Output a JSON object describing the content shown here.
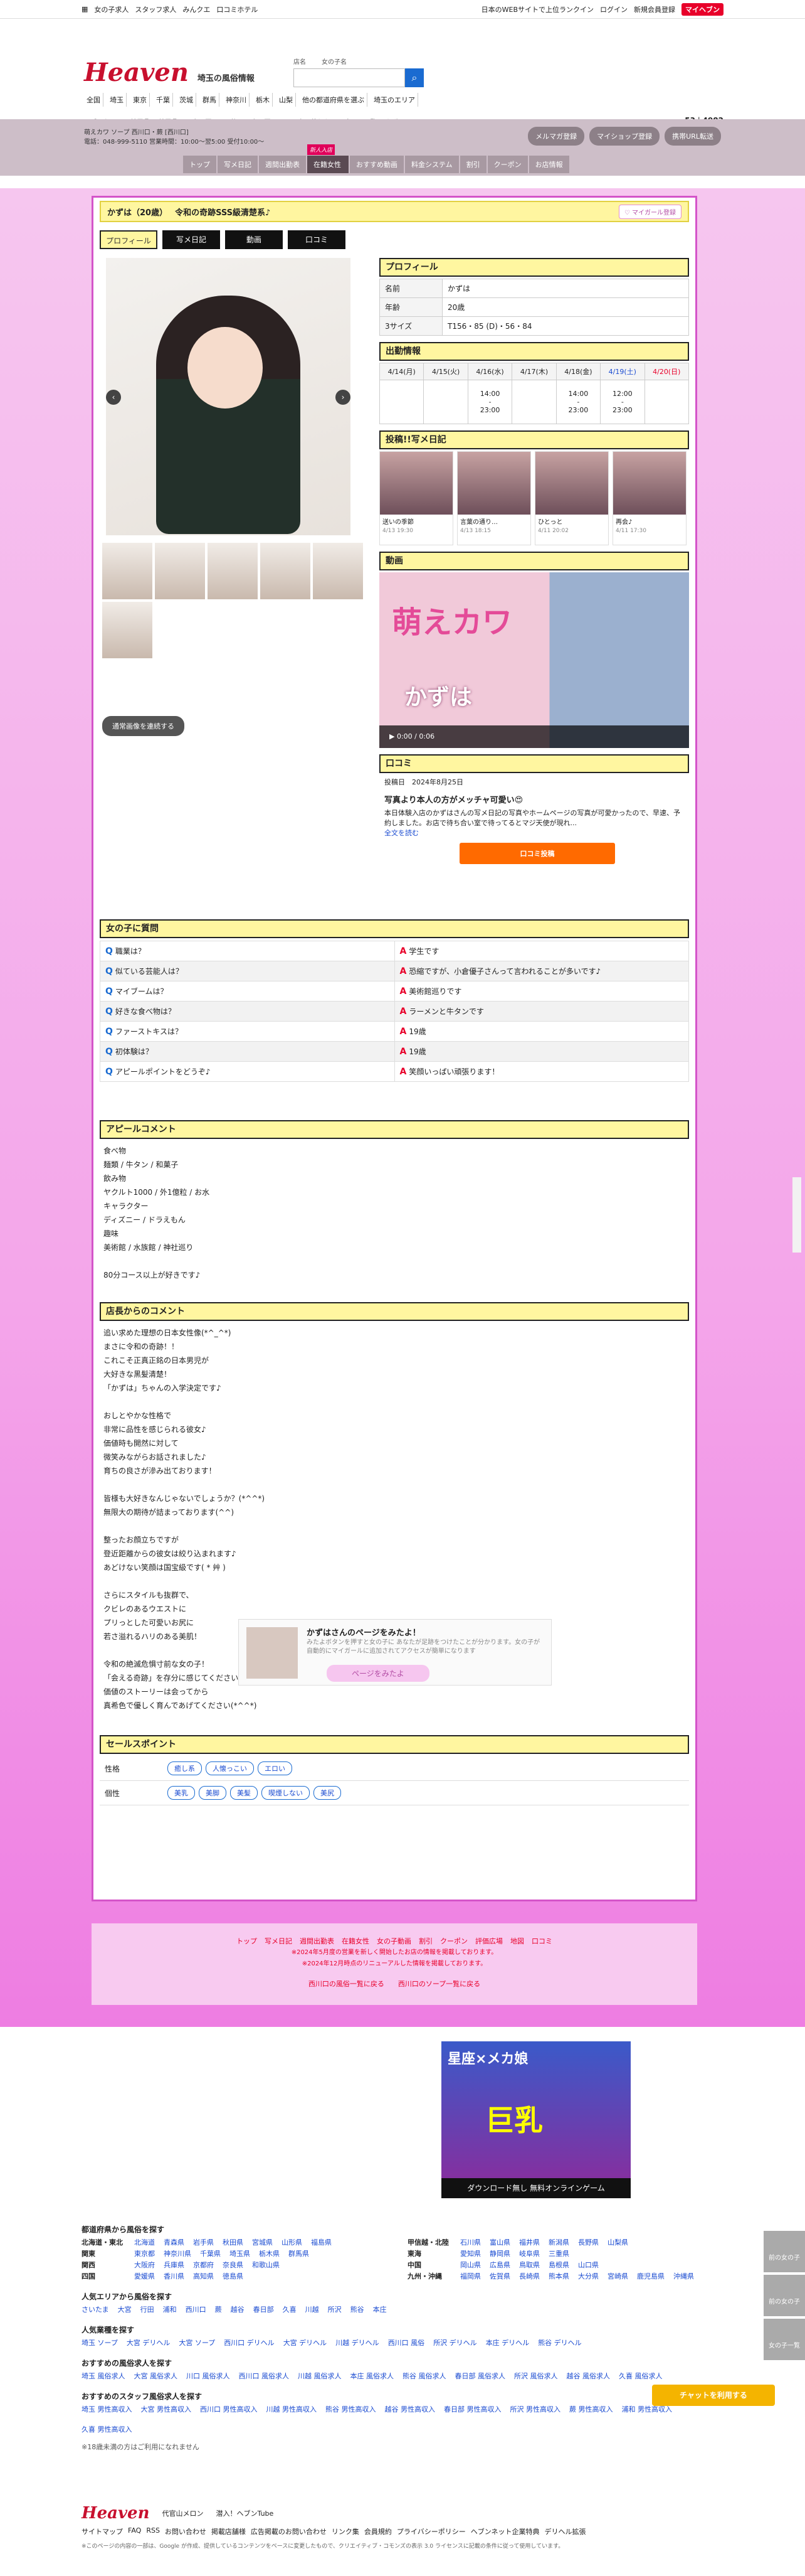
{
  "topbar": {
    "links": [
      "女の子求人",
      "スタッフ求人",
      "みんクエ",
      "口コミホテル"
    ],
    "right": [
      "日本のWEBサイトで上位ランクイン",
      "ログイン",
      "新規会員登録"
    ],
    "myheaven": "マイヘブン"
  },
  "header": {
    "logo": "Heaven",
    "region": "埼玉",
    "region_sub": "の風俗情報",
    "search_label_shop": "店名",
    "search_label_girl": "女の子名",
    "areas": [
      "全国",
      "埼玉",
      "東京",
      "千葉",
      "茨城",
      "群馬",
      "神奈川",
      "栃木",
      "山梨",
      "他の都道府県を選ぶ",
      "埼玉のエリア"
    ],
    "breadcrumb": "ヘブンネット > 埼玉県 > 埼玉県ソープ > 西川口・蕨ソープ > 西川口ソープ > 萌えカワ > 女の子一覧 > かずは",
    "count_a": "53",
    "count_b": "4982"
  },
  "shop": {
    "info_line1": "萌えカワ ソープ 西川口・蕨 [西川口]",
    "info_line2": "電話：048-999-5110 営業時間：10:00〜翌5:00 受付10:00〜",
    "buttons": [
      "メルマガ登録",
      "マイショップ登録",
      "携帯URL転送"
    ],
    "tabs": [
      "トップ",
      "写メ日記",
      "週間出勤表",
      "在籍女性",
      "おすすめ動画",
      "料金システム",
      "割引",
      "クーポン",
      "お店情報"
    ],
    "new_badge": "新人入店"
  },
  "profile": {
    "name_age": "かずは（20歳）",
    "catch": "令和の奇跡SSS級清楚系♪",
    "mygirl": "マイガール登録",
    "tabs": [
      "プロフィール",
      "写メ日記",
      "動画",
      "口コミ"
    ],
    "heading": "プロフィール",
    "rows": [
      {
        "k": "名前",
        "v": "かずは"
      },
      {
        "k": "年齢",
        "v": "20歳"
      },
      {
        "k": "3サイズ",
        "v": "T156・85 (D)・56・84"
      }
    ],
    "all_images": "通常画像を連続する"
  },
  "schedule": {
    "heading": "出勤情報",
    "days": [
      "4/14(月)",
      "4/15(火)",
      "4/16(水)",
      "4/17(木)",
      "4/18(金)",
      "4/19(土)",
      "4/20(日)"
    ],
    "times": [
      "",
      "",
      "14:00\n-\n23:00",
      "",
      "14:00\n-\n23:00",
      "12:00\n-\n23:00",
      ""
    ]
  },
  "diary": {
    "heading": "投稿!!写メ日記",
    "items": [
      {
        "t": "送いの季節",
        "d": "4/13 19:30"
      },
      {
        "t": "言葉の通り…",
        "d": "4/13 18:15"
      },
      {
        "t": "ひとっと",
        "d": "4/11 20:02"
      },
      {
        "t": "再会♪",
        "d": "4/11 17:30"
      }
    ]
  },
  "video": {
    "heading": "動画",
    "title": "萌えカワ",
    "name": "かずは",
    "time": "0:00 / 0:06"
  },
  "review": {
    "heading": "口コミ",
    "date_label": "投稿日",
    "date": "2024年8月25日",
    "title": "写真より本人の方がメッチャ可愛い😍",
    "body": "本日体験入店のかずはさんの写メ日記の写真やホームページの写真が可愛かったので、早速、予約しました。お店で待ち合い室で待ってるとマジ天使が現れ...",
    "more": "全文を読む",
    "button": "口コミ投稿"
  },
  "qa": {
    "heading": "女の子に質問",
    "rows": [
      {
        "q": "職業は？",
        "a": "学生です"
      },
      {
        "q": "似ている芸能人は？",
        "a": "恐縮ですが、小倉優子さんって言われることが多いです♪"
      },
      {
        "q": "マイブームは？",
        "a": "美術館巡りです"
      },
      {
        "q": "好きな食べ物は？",
        "a": "ラーメンと牛タンです"
      },
      {
        "q": "ファーストキスは？",
        "a": "19歳"
      },
      {
        "q": "初体験は？",
        "a": "19歳"
      },
      {
        "q": "アピールポイントをどうぞ♪",
        "a": "笑顔いっぱい頑張ります！"
      }
    ]
  },
  "appeal": {
    "heading": "アピールコメント",
    "body": "食べ物\n麺類 / 牛タン / 和菓子\n飲み物\nヤクルト1000 / 外1億粒 / お水\nキャラクター\nディズニー / ドラえもん\n趣味\n美術館 / 水族館 / 神社巡り\n\n80分コース以上が好きです♪"
  },
  "manager": {
    "heading": "店長からのコメント",
    "body": "追い求めた理想の日本女性像(*^_^*)\nまさに令和の奇跡！！\nこれこそ正真正銘の日本男児が\n大好きな黒髪清楚！\n「かずは」ちゃんの入学決定です♪\n\nおしとやかな性格で\n非常に品性を感じられる彼女♪\n価値時も開然に対して\n微笑みながらお話されました♪\n育ちの良さが滲み出ております！\n\n皆様も大好きなんじゃないでしょうか？(*^^*)\n無限大の期待が詰まっております(^^)\n\n整ったお顔立ちですが\n登近距離からの彼女は絞り込まれます♪\nあどけない笑顔は国宝級です( * 艸 )\n\nさらにスタイルも抜群で、\nクビレのあるウエストに\nプリっとした可愛いお尻に\n若さ溢れるハリのある美肌！\n\n令和の絶滅危惧寸前な女の子！\n「会える奇跡」を存分に感じてください\n価値のストーリーは会ってから\n真希色で優しく育んであげてください(*^^*)"
  },
  "points": {
    "heading": "セールスポイント",
    "personality_label": "性格",
    "personality": [
      "癒し系",
      "人懐っこい",
      "エロい"
    ],
    "feature_label": "個性",
    "features": [
      "美乳",
      "美脚",
      "美髪",
      "喫煙しない",
      "美尻"
    ]
  },
  "ask": {
    "title": "かずはさんのページをみたよ！",
    "sub": "みたよボタンを押すと女の子に あなたが足跡をつけたことが分かります。女の子が自動的にマイガールに追加されてアクセスが簡単になります",
    "button": "ページをみたよ"
  },
  "footnav": {
    "links": [
      "トップ",
      "写メ日記",
      "週間出勤表",
      "在籍女性",
      "女の子動画",
      "割引",
      "クーポン",
      "評価広場",
      "地図",
      "口コミ"
    ],
    "note1": "※2024年5月度の営業を新しく開始したお店の情報を掲載しております。",
    "note2": "※2024年12月時点のリニューアルした情報を掲載しております。",
    "more1": "西川口の風俗一覧に戻る",
    "more2": "西川口のソープ一覧に戻る"
  },
  "ad": {
    "t1": "星座×メカ娘",
    "t2": "巨乳",
    "t3": "ダウンロード無し 無料オンラインゲーム"
  },
  "bottom": {
    "h1": "都道府県から風俗を探す",
    "regions": [
      {
        "k": "北海道・東北",
        "v": [
          "北海道",
          "青森県",
          "岩手県",
          "秋田県",
          "宮城県",
          "山形県",
          "福島県"
        ]
      },
      {
        "k": "関東",
        "v": [
          "東京都",
          "神奈川県",
          "千葉県",
          "埼玉県",
          "栃木県",
          "群馬県"
        ]
      },
      {
        "k": "関西",
        "v": [
          "大阪府",
          "兵庫県",
          "京都府",
          "奈良県",
          "和歌山県"
        ]
      },
      {
        "k": "四国",
        "v": [
          "愛媛県",
          "香川県",
          "高知県",
          "徳島県"
        ]
      }
    ],
    "regions2": [
      {
        "k": "甲信越・北陸",
        "v": [
          "石川県",
          "富山県",
          "福井県",
          "新潟県",
          "長野県",
          "山梨県"
        ]
      },
      {
        "k": "東海",
        "v": [
          "愛知県",
          "静岡県",
          "岐阜県",
          "三重県"
        ]
      },
      {
        "k": "中国",
        "v": [
          "岡山県",
          "広島県",
          "鳥取県",
          "島根県",
          "山口県"
        ]
      },
      {
        "k": "九州・沖縄",
        "v": [
          "福岡県",
          "佐賀県",
          "長崎県",
          "熊本県",
          "大分県",
          "宮崎県",
          "鹿児島県",
          "沖縄県"
        ]
      }
    ],
    "h2": "人気エリアから風俗を探す",
    "popular": [
      "さいたま",
      "大宮",
      "行田",
      "浦和",
      "西川口",
      "蕨",
      "越谷",
      "春日部",
      "久喜",
      "川越",
      "所沢",
      "熊谷",
      "本庄"
    ],
    "h3": "人気業種を探す",
    "industry": [
      "埼玉 ソープ",
      "大宮 デリヘル",
      "大宮 ソープ",
      "西川口 デリヘル",
      "大宮 デリヘル",
      "川越 デリヘル",
      "西川口 風俗",
      "所沢 デリヘル",
      "本庄 デリヘル",
      "熊谷 デリヘル"
    ],
    "h4": "おすすめの風俗求人を探す",
    "jobs": [
      "埼玉 風俗求人",
      "大宮 風俗求人",
      "川口 風俗求人",
      "西川口 風俗求人",
      "川越 風俗求人",
      "本庄 風俗求人",
      "熊谷 風俗求人",
      "春日部 風俗求人",
      "所沢 風俗求人",
      "越谷 風俗求人",
      "久喜 風俗求人"
    ],
    "h5": "おすすめのスタッフ風俗求人を探す",
    "staff": [
      "埼玉 男性高収入",
      "大宮 男性高収入",
      "西川口 男性高収入",
      "川越 男性高収入",
      "熊谷 男性高収入",
      "越谷 男性高収入",
      "春日部 男性高収入",
      "所沢 男性高収入",
      "蕨 男性高収入",
      "浦和 男性高収入",
      "久喜 男性高収入"
    ],
    "note": "※18歳未満の方はご利用になれません"
  },
  "legal": {
    "logo": "Heaven",
    "l1": "代官山メロン",
    "l2": "潜入！ヘブンTube",
    "links": [
      "サイトマップ",
      "FAQ",
      "RSS",
      "お問い合わせ",
      "掲載店舗様",
      "広告掲載のお問い合わせ",
      "リンク集",
      "会員規約",
      "プライバシーポリシー",
      "ヘブンネット企業特典",
      "デリヘル拡張"
    ],
    "notice": "※このページの内容の一部は、Google が作成、提供しているコンテンツをベースに変更したもので、クリエイティブ・コモンズの表示 3.0 ライセンスに記載の条件に従って使用しています。"
  },
  "float": [
    "前の女の子",
    "前の女の子",
    "女の子一覧"
  ],
  "kiwi": "チャットを利用する"
}
